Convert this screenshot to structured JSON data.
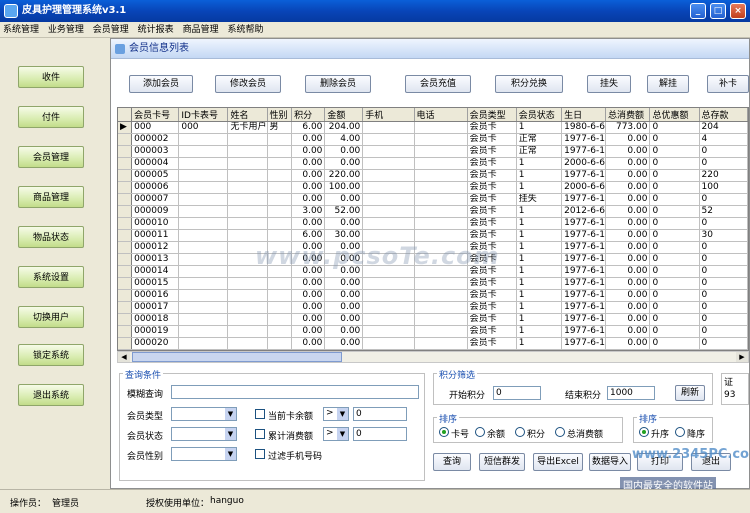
{
  "window": {
    "title": "皮具护理管理系统v3.1"
  },
  "menu": [
    "系统管理",
    "业务管理",
    "会员管理",
    "统计报表",
    "商品管理",
    "系统帮助"
  ],
  "sidebar": [
    "收件",
    "付件",
    "会员管理",
    "商品管理",
    "物品状态",
    "系统设置",
    "切换用户",
    "锁定系统",
    "退出系统"
  ],
  "main": {
    "title": "会员信息列表"
  },
  "toolbar": [
    "添加会员",
    "修改会员",
    "删除会员",
    "会员充值",
    "积分兑换",
    "挂失",
    "解挂",
    "补卡"
  ],
  "table": {
    "columns": [
      "会员卡号",
      "ID卡表号",
      "姓名",
      "性别",
      "积分",
      "金额",
      "手机",
      "电话",
      "会员类型",
      "会员状态",
      "生日",
      "总消费额",
      "总优惠额",
      "总存款"
    ],
    "rows": [
      [
        "000",
        "000",
        "无卡用户",
        "男",
        "6.00",
        "204.00",
        "",
        "",
        "会员卡",
        "1",
        "1980-6-6",
        "773.00",
        "0",
        "204"
      ],
      [
        "000002",
        "",
        "",
        "",
        "0.00",
        "4.00",
        "",
        "",
        "会员卡",
        "正常",
        "1977-6-1",
        "0.00",
        "0",
        "4"
      ],
      [
        "000003",
        "",
        "",
        "",
        "0.00",
        "0.00",
        "",
        "",
        "会员卡",
        "正常",
        "1977-6-1",
        "0.00",
        "0",
        "0"
      ],
      [
        "000004",
        "",
        "",
        "",
        "0.00",
        "0.00",
        "",
        "",
        "会员卡",
        "1",
        "2000-6-6",
        "0.00",
        "0",
        "0"
      ],
      [
        "000005",
        "",
        "",
        "",
        "0.00",
        "220.00",
        "",
        "",
        "会员卡",
        "1",
        "1977-6-1",
        "0.00",
        "0",
        "220"
      ],
      [
        "000006",
        "",
        "",
        "",
        "0.00",
        "100.00",
        "",
        "",
        "会员卡",
        "1",
        "2000-6-6",
        "0.00",
        "0",
        "100"
      ],
      [
        "000007",
        "",
        "",
        "",
        "0.00",
        "0.00",
        "",
        "",
        "会员卡",
        "挂失",
        "1977-6-1",
        "0.00",
        "0",
        "0"
      ],
      [
        "000009",
        "",
        "",
        "",
        "3.00",
        "52.00",
        "",
        "",
        "会员卡",
        "1",
        "2012-6-6",
        "0.00",
        "0",
        "52"
      ],
      [
        "000010",
        "",
        "",
        "",
        "0.00",
        "0.00",
        "",
        "",
        "会员卡",
        "1",
        "1977-6-1",
        "0.00",
        "0",
        "0"
      ],
      [
        "000011",
        "",
        "",
        "",
        "6.00",
        "30.00",
        "",
        "",
        "会员卡",
        "1",
        "1977-6-1",
        "0.00",
        "0",
        "30"
      ],
      [
        "000012",
        "",
        "",
        "",
        "0.00",
        "0.00",
        "",
        "",
        "会员卡",
        "1",
        "1977-6-1",
        "0.00",
        "0",
        "0"
      ],
      [
        "000013",
        "",
        "",
        "",
        "0.00",
        "0.00",
        "",
        "",
        "会员卡",
        "1",
        "1977-6-1",
        "0.00",
        "0",
        "0"
      ],
      [
        "000014",
        "",
        "",
        "",
        "0.00",
        "0.00",
        "",
        "",
        "会员卡",
        "1",
        "1977-6-1",
        "0.00",
        "0",
        "0"
      ],
      [
        "000015",
        "",
        "",
        "",
        "0.00",
        "0.00",
        "",
        "",
        "会员卡",
        "1",
        "1977-6-1",
        "0.00",
        "0",
        "0"
      ],
      [
        "000016",
        "",
        "",
        "",
        "0.00",
        "0.00",
        "",
        "",
        "会员卡",
        "1",
        "1977-6-1",
        "0.00",
        "0",
        "0"
      ],
      [
        "000017",
        "",
        "",
        "",
        "0.00",
        "0.00",
        "",
        "",
        "会员卡",
        "1",
        "1977-6-1",
        "0.00",
        "0",
        "0"
      ],
      [
        "000018",
        "",
        "",
        "",
        "0.00",
        "0.00",
        "",
        "",
        "会员卡",
        "1",
        "1977-6-1",
        "0.00",
        "0",
        "0"
      ],
      [
        "000019",
        "",
        "",
        "",
        "0.00",
        "0.00",
        "",
        "",
        "会员卡",
        "1",
        "1977-6-1",
        "0.00",
        "0",
        "0"
      ],
      [
        "000020",
        "",
        "",
        "",
        "0.00",
        "0.00",
        "",
        "",
        "会员卡",
        "1",
        "1977-6-1",
        "0.00",
        "0",
        "0"
      ]
    ]
  },
  "query": {
    "title": "查询条件",
    "fuzzy_label": "模糊查询",
    "type_label": "会员类型",
    "status_label": "会员状态",
    "gender_label": "会员性别",
    "cb_balance": "当前卡余额",
    "cb_total": "累计消费额",
    "cb_filter_mobile": "过滤手机号码",
    "op1": ">",
    "val1": "0",
    "op2": ">",
    "val2": "0"
  },
  "points": {
    "title": "积分筛选",
    "start_label": "开始积分",
    "start_value": "0",
    "end_label": "结束积分",
    "end_value": "1000",
    "refresh": "刷新"
  },
  "sort": {
    "title": "排序",
    "options": [
      "卡号",
      "余额",
      "积分",
      "总消费额"
    ]
  },
  "order": {
    "title": "排序",
    "options": [
      "升序",
      "降序"
    ]
  },
  "actions": [
    "查询",
    "短信群发",
    "导出Excel",
    "数据导入",
    "打印",
    "退出"
  ],
  "right_cut": {
    "label": "证",
    "value": "93"
  },
  "status": {
    "operator_label": "操作员：",
    "operator": "管理员",
    "licensee_label": "授权使用单位：",
    "licensee": "hanguo"
  },
  "watermark": "www.pcsoTe.com",
  "brand_watermark": {
    "site": "www.2345PC.com",
    "tag": "国内最安全的软件站"
  }
}
